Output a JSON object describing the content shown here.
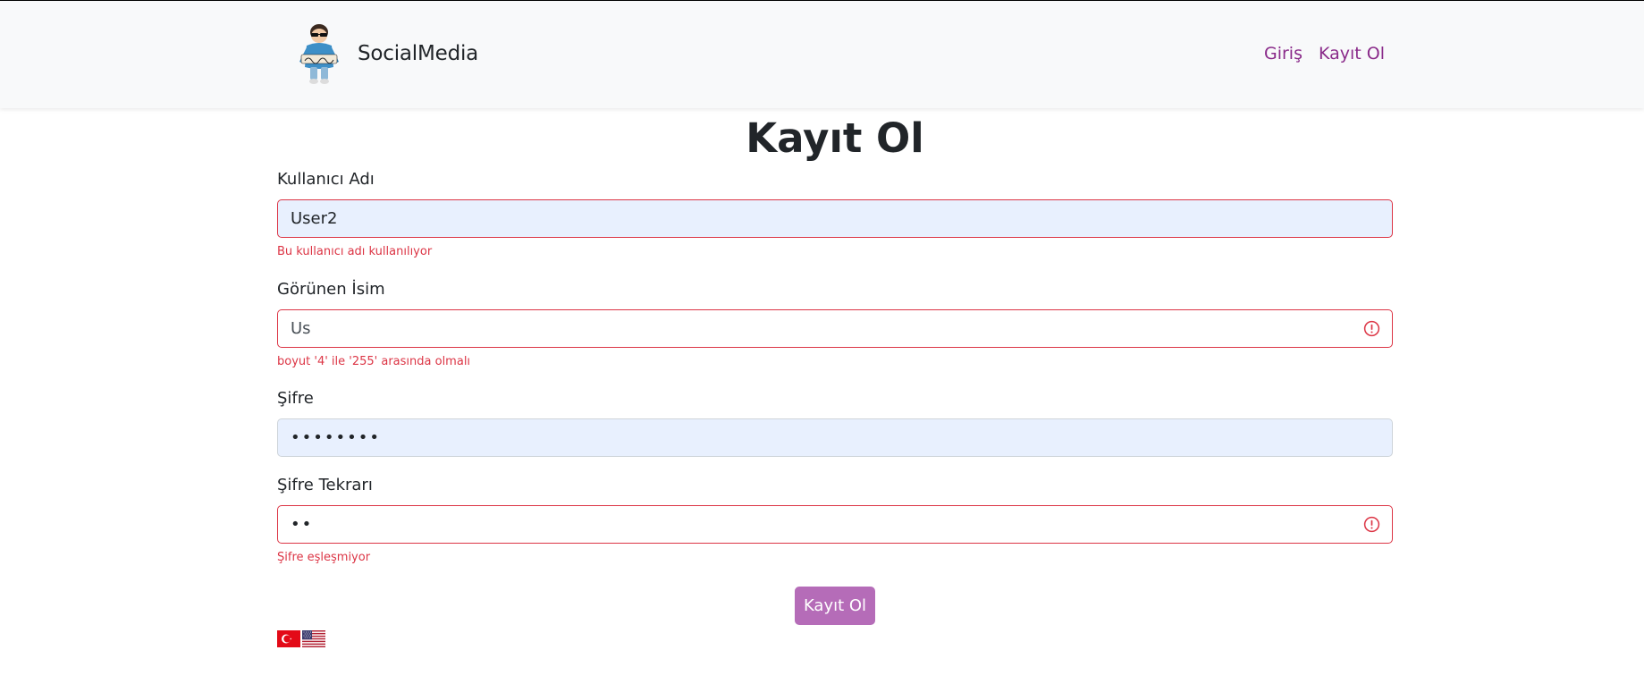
{
  "brand": {
    "name": "SocialMedia"
  },
  "nav": {
    "login": "Giriş",
    "register": "Kayıt Ol"
  },
  "page": {
    "title": "Kayıt Ol"
  },
  "form": {
    "username": {
      "label": "Kullanıcı Adı",
      "value": "User2",
      "error": "Bu kullanıcı adı kullanılıyor"
    },
    "display_name": {
      "label": "Görünen İsim",
      "value": "Us",
      "error": "boyut '4' ile '255' arasında olmalı"
    },
    "password": {
      "label": "Şifre",
      "value": "••••••••"
    },
    "password_repeat": {
      "label": "Şifre Tekrarı",
      "value": "••",
      "error": "Şifre eşleşmiyor"
    },
    "submit_label": "Kayıt Ol"
  },
  "languages": [
    "tr",
    "en"
  ],
  "colors": {
    "accent": "#8a2b8a",
    "button": "#b56cb8",
    "error": "#dc3545",
    "autofill": "#e8f0fe",
    "navbar_bg": "#f8f9fa"
  },
  "icons": {
    "error": "exclamation-circle-icon"
  }
}
